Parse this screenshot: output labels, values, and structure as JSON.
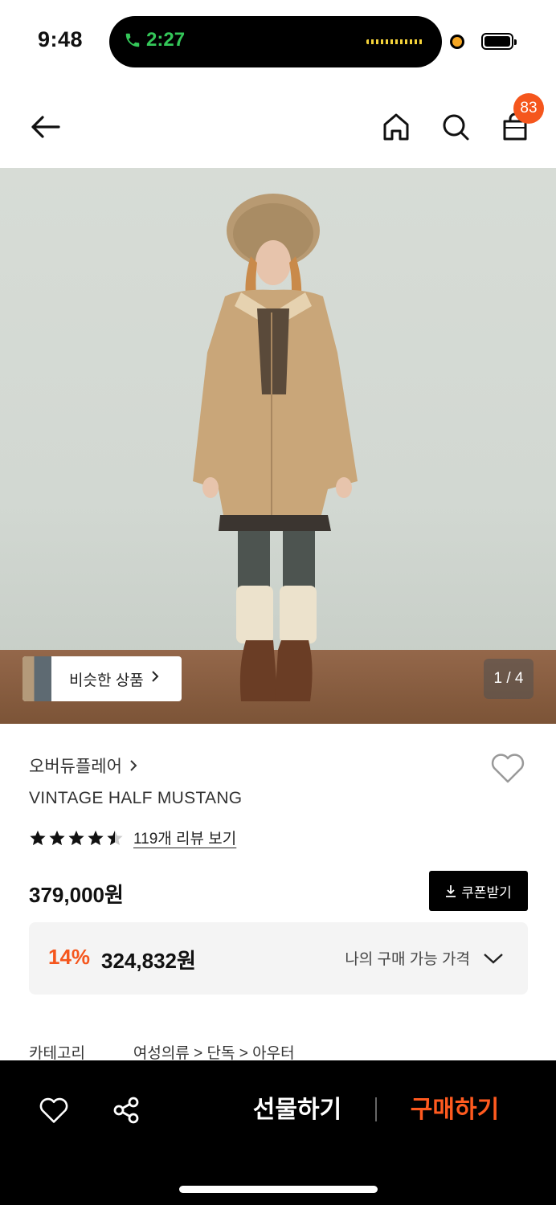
{
  "status_bar": {
    "time": "9:48",
    "call_time": "2:27"
  },
  "nav": {
    "cart_count": "83"
  },
  "gallery": {
    "similar_label": "비슷한 상품",
    "page_indicator": "1 / 4"
  },
  "product": {
    "brand": "오버듀플레어",
    "name": "VINTAGE HALF MUSTANG",
    "rating": 4.5,
    "review_link": "119개 리뷰 보기",
    "price": "379,000원",
    "coupon_label": "쿠폰받기",
    "discount_pct": "14%",
    "discount_price": "324,832원",
    "my_price_label": "나의 구매 가능 가격",
    "category_label": "카테고리",
    "category_path": "여성의류 > 단독 > 아우터"
  },
  "bottom_bar": {
    "gift_label": "선물하기",
    "buy_label": "구매하기"
  },
  "colors": {
    "accent": "#f5561d",
    "buy": "#ff5a1f",
    "call": "#34c759"
  },
  "icons": [
    "back-arrow-icon",
    "home-icon",
    "search-icon",
    "bag-icon",
    "heart-icon",
    "share-icon",
    "download-icon",
    "chevron-down-icon",
    "chevron-right-icon",
    "star-icon"
  ]
}
